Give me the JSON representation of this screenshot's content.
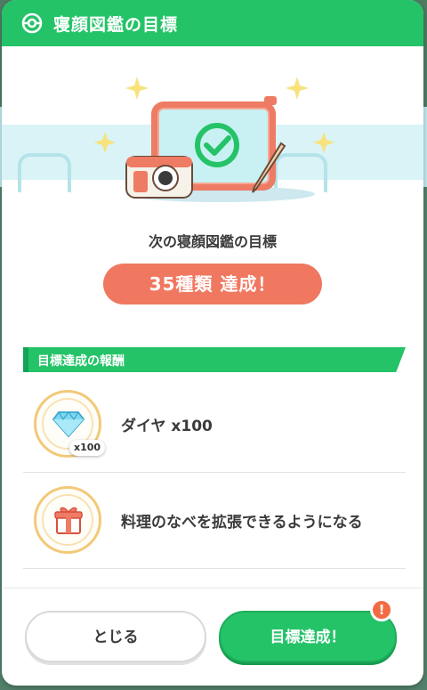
{
  "header": {
    "title": "寝顔図鑑の目標",
    "icon": "pokeball-icon"
  },
  "hero": {
    "illustration": "tablet-camera-checkmark-icon"
  },
  "next_goal": {
    "label": "次の寝顔図鑑の目標",
    "goal_text": "35種類 達成！"
  },
  "rewards_section": {
    "title": "目標達成の報酬",
    "items": [
      {
        "icon": "diamond-icon",
        "label": "ダイヤ x100",
        "quantity_badge": "x100"
      },
      {
        "icon": "gift-icon",
        "label": "料理のなべを拡張できるようになる"
      }
    ]
  },
  "buttons": {
    "close_label": "とじる",
    "achieve_label": "目標達成！",
    "alert_badge": "!"
  },
  "colors": {
    "primary_green": "#25c368",
    "goal_pill": "#f07860",
    "alert": "#f26b43"
  }
}
